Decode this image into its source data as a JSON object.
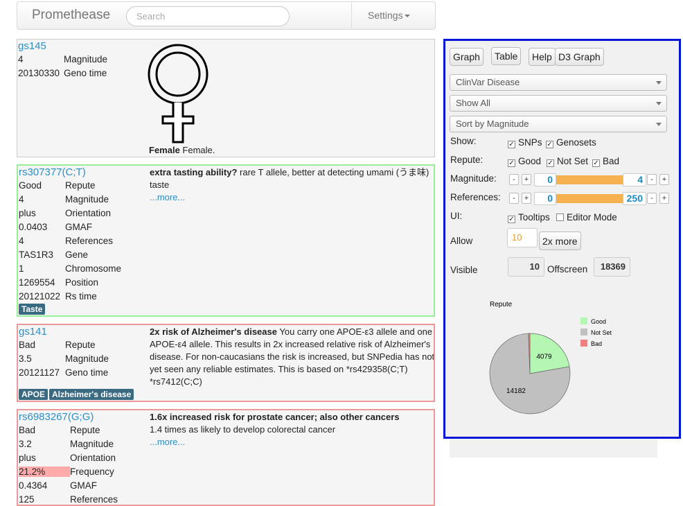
{
  "navbar": {
    "brand": "Promethease",
    "search_placeholder": "Search",
    "settings": "Settings"
  },
  "card1": {
    "title": "gs145",
    "rows": [
      [
        "4",
        "Magnitude"
      ],
      [
        "20130330",
        "Geno time"
      ]
    ],
    "caption_bold": "Female",
    "caption": " Female."
  },
  "card2": {
    "title": "rs307377(C;T)",
    "rows": [
      [
        "Good",
        "Repute"
      ],
      [
        "4",
        "Magnitude"
      ],
      [
        "plus",
        "Orientation"
      ],
      [
        "0.0403",
        "GMAF"
      ],
      [
        "4",
        "References"
      ],
      [
        "TAS1R3",
        "Gene"
      ],
      [
        "1",
        "Chromosome"
      ],
      [
        "1269554",
        "Position"
      ],
      [
        "20121022",
        "Rs time"
      ]
    ],
    "desc_bold": "extra tasting ability?",
    "desc": " rare T allele, better at detecting umami (うま味) taste",
    "more": "...more...",
    "tags": [
      "Taste"
    ]
  },
  "card3": {
    "title": "gs141",
    "rows": [
      [
        "Bad",
        "Repute"
      ],
      [
        "3.5",
        "Magnitude"
      ],
      [
        "20121127",
        "Geno time"
      ]
    ],
    "desc_bold": "2x risk of Alzheimer's disease",
    "desc": " You carry one APOE-ε3 allele and one APOE-ε4 allele. This results in 2x increased relative risk of Alzheimer's disease. For non-caucasians the risk is increased, but SNPedia has not yet seen any reliable estimates. This is based on *rs429358(C;T) *rs7412(C;C)",
    "tags": [
      "APOE",
      "Alzheimer's disease"
    ]
  },
  "card4": {
    "title": "rs6983267(G;G)",
    "rows": [
      [
        "Bad",
        "Repute"
      ],
      [
        "3.2",
        "Magnitude"
      ],
      [
        "plus",
        "Orientation"
      ],
      [
        "21.2%",
        "Frequency"
      ],
      [
        "0.4364",
        "GMAF"
      ],
      [
        "125",
        "References"
      ]
    ],
    "desc_bold": "1.6x increased risk for prostate cancer; also other cancers",
    "desc": "1.4 times as likely to develop colorectal cancer",
    "more": "...more..."
  },
  "panel": {
    "buttons": {
      "graph": "Graph",
      "table": "Table",
      "help": "Help",
      "d3": "D3 Graph"
    },
    "selects": [
      "ClinVar Disease",
      "Show All",
      "Sort by Magnitude"
    ],
    "show_label": "Show:",
    "snps": "SNPs",
    "genosets": "Genosets",
    "repute_label": "Repute:",
    "good": "Good",
    "notset": "Not Set",
    "bad": "Bad",
    "magnitude_label": "Magnitude:",
    "mag_min": "0",
    "mag_max": "4",
    "references_label": "References:",
    "ref_min": "0",
    "ref_max": "250",
    "ui_label": "UI:",
    "tooltips": "Tooltips",
    "editor": "Editor Mode",
    "allow_label": "Allow",
    "allow_value": "10",
    "more_btn": "2x more",
    "visible_label": "Visible",
    "visible_value": "10",
    "offscreen_label": "Offscreen",
    "offscreen_value": "18369",
    "minus": "-",
    "plus": "+",
    "check": "✓"
  },
  "chart_data": {
    "type": "pie",
    "title": "Repute",
    "categories": [
      "Good",
      "Not Set",
      "Bad"
    ],
    "values": [
      4079,
      14182,
      108
    ],
    "labels": [
      "4079",
      "14182",
      ""
    ],
    "colors": [
      "#b3f7b3",
      "#c0c0c0",
      "#f08080"
    ],
    "legend": "top-right"
  }
}
